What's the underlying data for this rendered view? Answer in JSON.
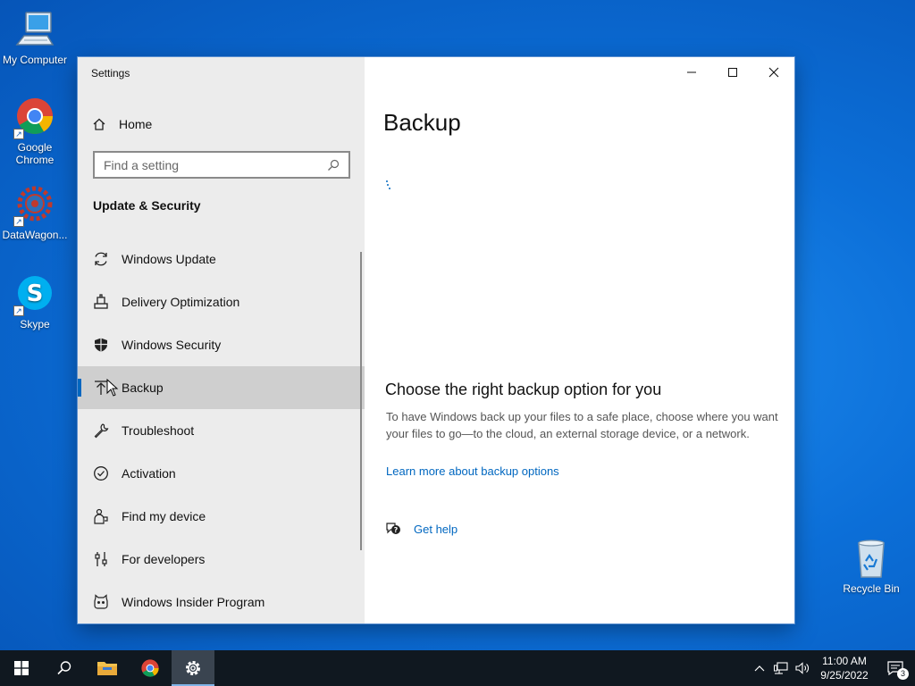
{
  "desktop": {
    "icons": [
      {
        "label": "My Computer"
      },
      {
        "label": "Google Chrome"
      },
      {
        "label": "DataWagon..."
      },
      {
        "label": "Skype"
      },
      {
        "label": "Recycle Bin"
      }
    ]
  },
  "window": {
    "title": "Settings",
    "sidebar": {
      "home_label": "Home",
      "search_placeholder": "Find a setting",
      "section_title": "Update & Security",
      "items": [
        {
          "label": "Windows Update",
          "icon": "refresh-icon"
        },
        {
          "label": "Delivery Optimization",
          "icon": "delivery-optimization-icon"
        },
        {
          "label": "Windows Security",
          "icon": "shield-icon"
        },
        {
          "label": "Backup",
          "icon": "backup-upload-icon",
          "selected": true
        },
        {
          "label": "Troubleshoot",
          "icon": "wrench-icon"
        },
        {
          "label": "Activation",
          "icon": "check-circle-icon"
        },
        {
          "label": "Find my device",
          "icon": "person-location-icon"
        },
        {
          "label": "For developers",
          "icon": "developer-sliders-icon"
        },
        {
          "label": "Windows Insider Program",
          "icon": "insider-cat-icon"
        }
      ]
    },
    "content": {
      "page_title": "Backup",
      "heading": "Choose the right backup option for you",
      "description": "To have Windows back up your files to a safe place, choose where you want your files to go—to the cloud, an external storage device, or a network.",
      "link": "Learn more about backup options",
      "help_label": "Get help"
    }
  },
  "taskbar": {
    "time": "11:00 AM",
    "date": "9/25/2022",
    "notification_count": "3"
  },
  "colors": {
    "accent": "#0067c0",
    "taskbar": "#101820",
    "sidebar": "#ececec"
  }
}
